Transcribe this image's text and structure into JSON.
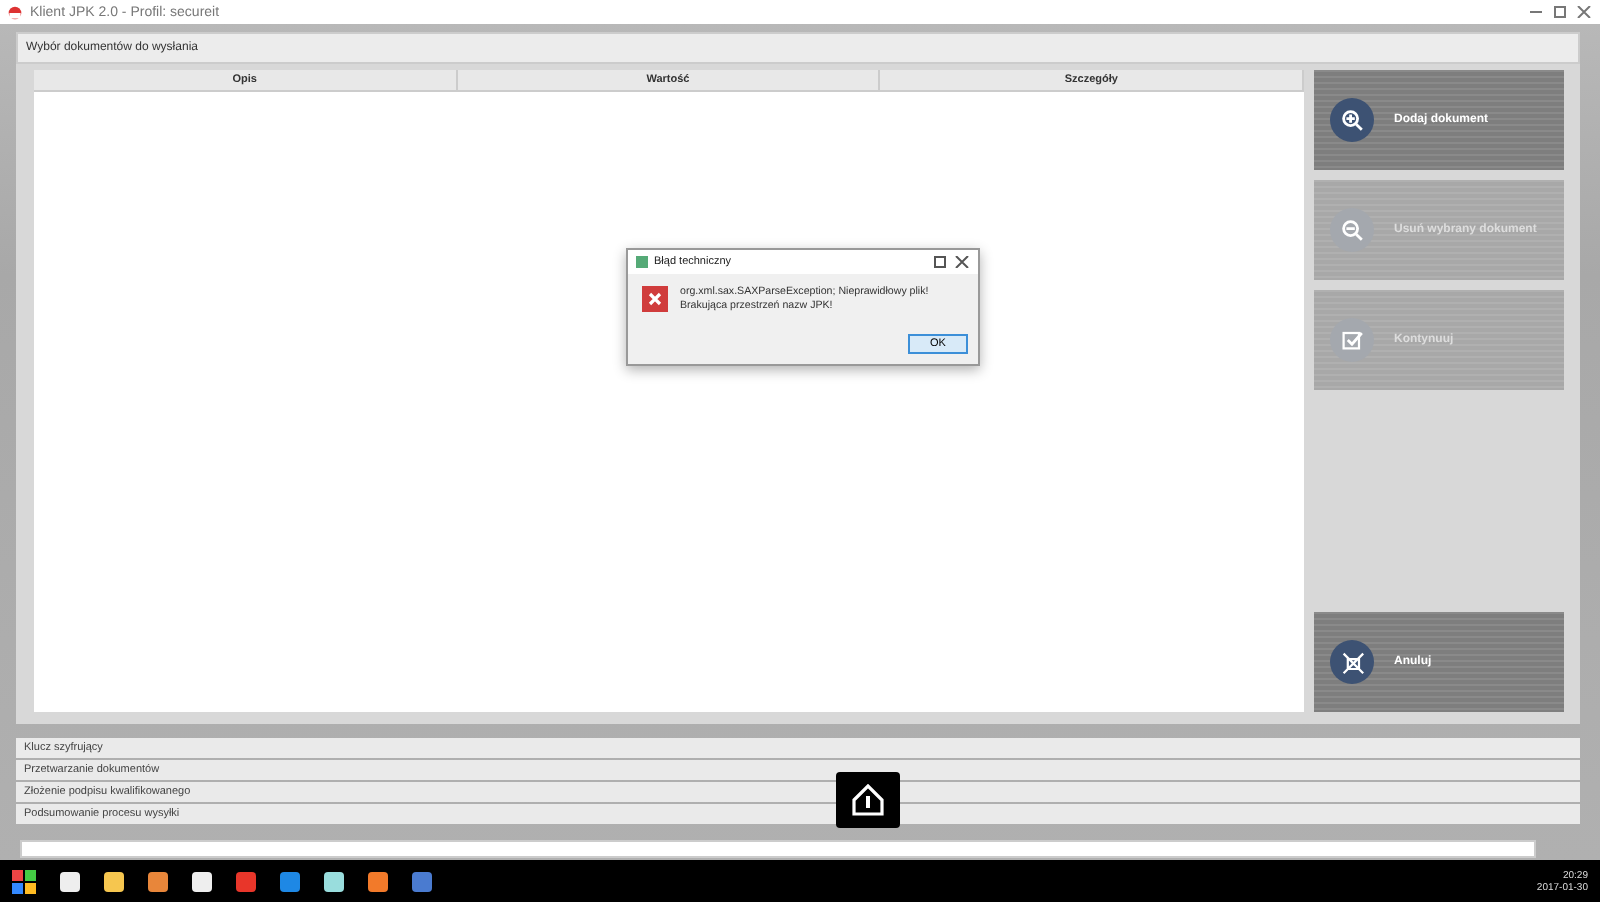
{
  "window": {
    "title": "Klient JPK 2.0 - Profil: secureit"
  },
  "panel": {
    "title": "Wybór dokumentów do wysłania"
  },
  "table": {
    "columns": [
      "Opis",
      "Wartość",
      "Szczegóły"
    ]
  },
  "actions": [
    {
      "kind": "add",
      "label": "Dodaj dokument",
      "disabled": false
    },
    {
      "kind": "remove",
      "label": "Usuń wybrany dokument",
      "disabled": true
    },
    {
      "kind": "check",
      "label": "Kontynuuj",
      "disabled": true
    },
    {
      "kind": "cancel",
      "label": "Anuluj",
      "disabled": false
    }
  ],
  "steps": [
    "Klucz szyfrujący",
    "Przetwarzanie dokumentów",
    "Złożenie podpisu kwalifikowanego",
    "Podsumowanie procesu wysyłki"
  ],
  "dialog": {
    "title": "Błąd techniczny",
    "message": "org.xml.sax.SAXParseException; Nieprawidłowy plik! Brakująca przestrzeń nazw JPK!",
    "button": "OK"
  },
  "progress": {
    "level": 0
  },
  "taskbar": {
    "time": "20:29",
    "date": "2017-01-30"
  }
}
